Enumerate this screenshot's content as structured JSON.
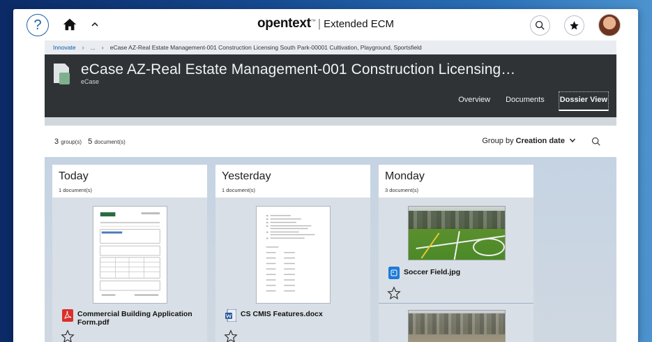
{
  "topbar": {
    "help": "?",
    "brand_logo": "opentext",
    "brand_tm": "™",
    "brand_sep": "|",
    "brand_product": "Extended ECM"
  },
  "breadcrumb": {
    "root": "Innovate",
    "ellipsis": "...",
    "current": "eCase AZ-Real Estate Management-001 Construction Licensing South Park-00001 Cultivation, Playground, Sportsfield"
  },
  "header": {
    "title": "eCase AZ-Real Estate Management-001 Construction Licensing…",
    "type": "eCase",
    "tabs": [
      "Overview",
      "Documents",
      "Dossier View"
    ]
  },
  "toolbar": {
    "group_count": "3",
    "group_label": "group(s)",
    "doc_count": "5",
    "doc_label": "document(s)",
    "group_by_label": "Group by",
    "group_by_value": "Creation date"
  },
  "columns": [
    {
      "title": "Today",
      "count": "1 document(s)",
      "docs": [
        {
          "name": "Commercial Building Application Form.pdf",
          "icon": "pdf-icon"
        }
      ]
    },
    {
      "title": "Yesterday",
      "count": "1 document(s)",
      "docs": [
        {
          "name": "CS CMIS Features.docx",
          "icon": "word-icon"
        }
      ]
    },
    {
      "title": "Monday",
      "count": "3 document(s)",
      "docs": [
        {
          "name": "Soccer Field.jpg",
          "icon": "image-icon"
        }
      ]
    }
  ],
  "colors": {
    "header_bg": "#2f3336",
    "link": "#0e59a6",
    "pdf_red": "#d9302b",
    "word_blue": "#2b5797",
    "image_blue": "#1e7bd6"
  }
}
